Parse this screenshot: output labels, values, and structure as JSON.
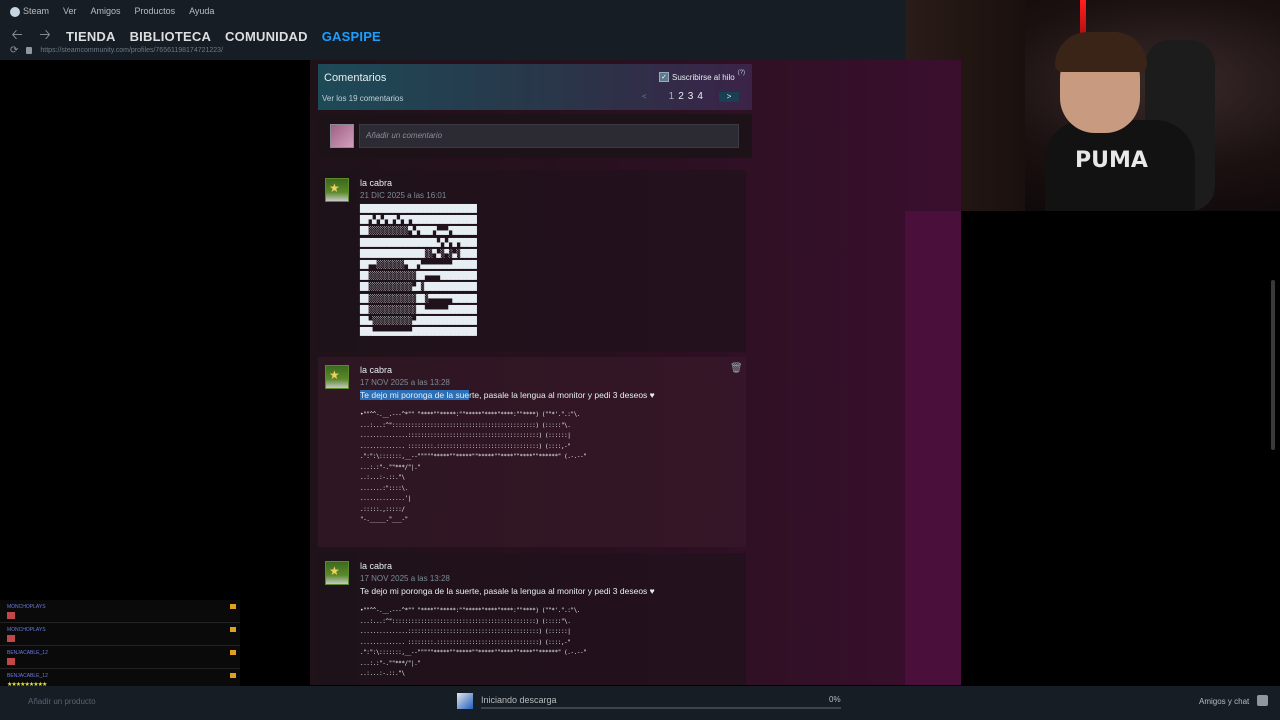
{
  "menu": {
    "items": [
      "Steam",
      "Ver",
      "Amigos",
      "Productos",
      "Ayuda"
    ]
  },
  "nav": {
    "back_icon": "arrow-left-icon",
    "forward_icon": "arrow-right-icon",
    "tabs": [
      "TIENDA",
      "BIBLIOTECA",
      "COMUNIDAD",
      "GASPIPE"
    ],
    "active_tab": "GASPIPE",
    "url": "https://steamcommunity.com/profiles/76561198174721223/"
  },
  "comments": {
    "title": "Comentarios",
    "count_text": "Ver los 19 comentarios",
    "subscribe_label": "Suscribirse al hilo",
    "subscribe_help": "(?)",
    "pager": {
      "prev": "<",
      "pages": [
        "1",
        "2",
        "3",
        "4"
      ],
      "current": "1",
      "next": ">"
    },
    "add_placeholder": "Añadir un comentario",
    "items": [
      {
        "author": "la cabra",
        "date": "21 DIC 2025 a las 16:01",
        "body": ""
      },
      {
        "author": "la cabra",
        "date": "17 NOV 2025 a las 13:28",
        "body_highlight": "Te dejo mi poronga de la sue",
        "body_rest": "rte, pasale la lengua al monitor y pedi 3 deseos ♥"
      },
      {
        "author": "la cabra",
        "date": "17 NOV 2025 a las 13:28",
        "body": "Te dejo mi poronga de la suerte, pasale la lengua al monitor y pedi 3 deseos ♥"
      }
    ]
  },
  "chat": {
    "rows": [
      {
        "user": "MONCHOPLAYS"
      },
      {
        "user": "MONCHOPLAYS"
      },
      {
        "user": "BENJACABLE_12"
      },
      {
        "user": "BENJACABLE_12"
      },
      {
        "user": "BENJACABLE_12"
      }
    ]
  },
  "bottom": {
    "add_game": "Añadir un producto",
    "download_status": "Iniciando descarga",
    "download_percent": "0%",
    "download_progress": 0,
    "friends_label": "Amigos y chat"
  },
  "colors": {
    "accent": "#1a9fff",
    "chrome": "#171d25",
    "highlight": "#2a6fb8"
  }
}
